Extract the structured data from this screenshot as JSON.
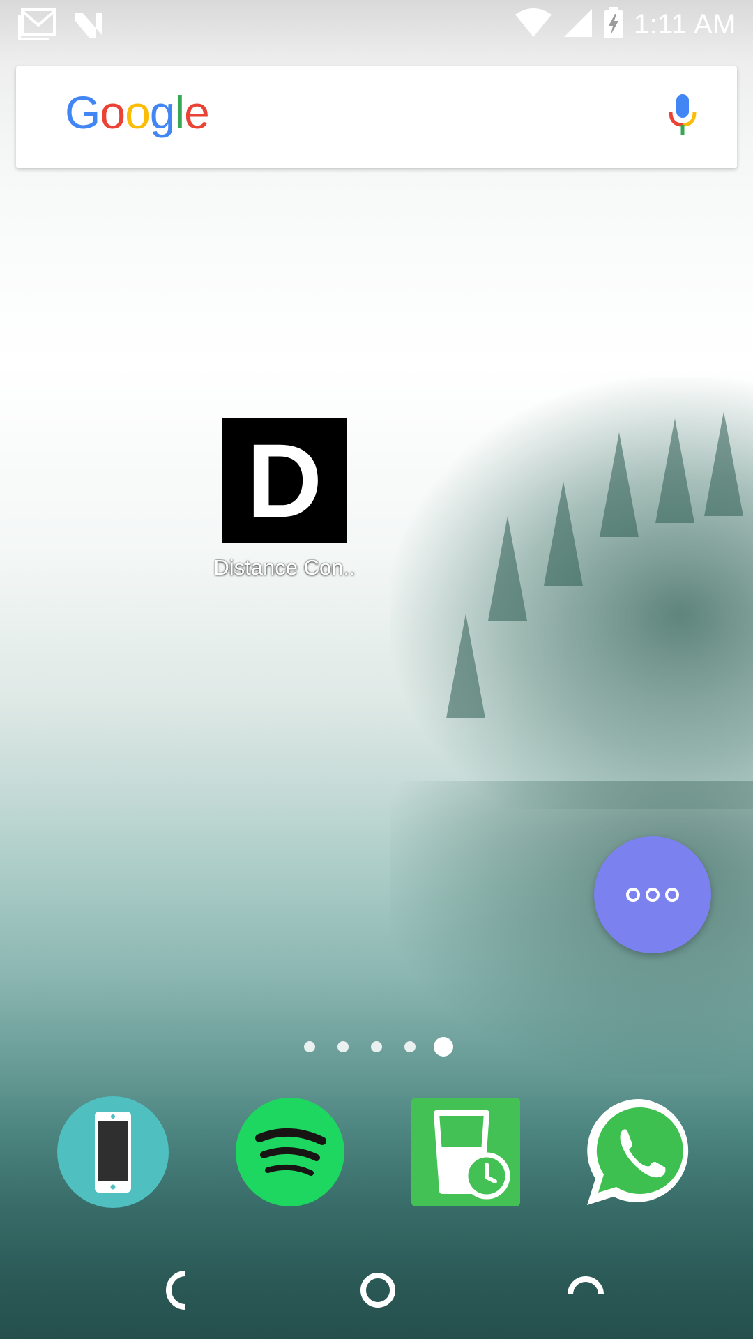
{
  "status_bar": {
    "time": "1:11 AM",
    "left_icons": [
      "gmail-notification-icon",
      "n-notification-icon"
    ],
    "right_icons": [
      "wifi-icon",
      "cell-signal-icon",
      "battery-charging-icon"
    ]
  },
  "search_widget": {
    "logo_text": "Google",
    "logo_colors": [
      "#4285F4",
      "#EA4335",
      "#FBBC05",
      "#4285F4",
      "#34A853",
      "#EA4335"
    ],
    "mic_icon": "mic-icon"
  },
  "home_apps": [
    {
      "label": "Distance Con..",
      "icon_letter": "D"
    }
  ],
  "floating_button": {
    "icon": "more-dots-icon",
    "color": "#7b82ef"
  },
  "page_indicator": {
    "count": 5,
    "active_index": 4
  },
  "dock": [
    {
      "icon": "phone-app-icon"
    },
    {
      "icon": "spotify-icon"
    },
    {
      "icon": "water-reminder-icon"
    },
    {
      "icon": "whatsapp-icon"
    }
  ],
  "nav_bar": {
    "buttons": [
      "back-icon",
      "home-icon",
      "recents-icon"
    ]
  }
}
